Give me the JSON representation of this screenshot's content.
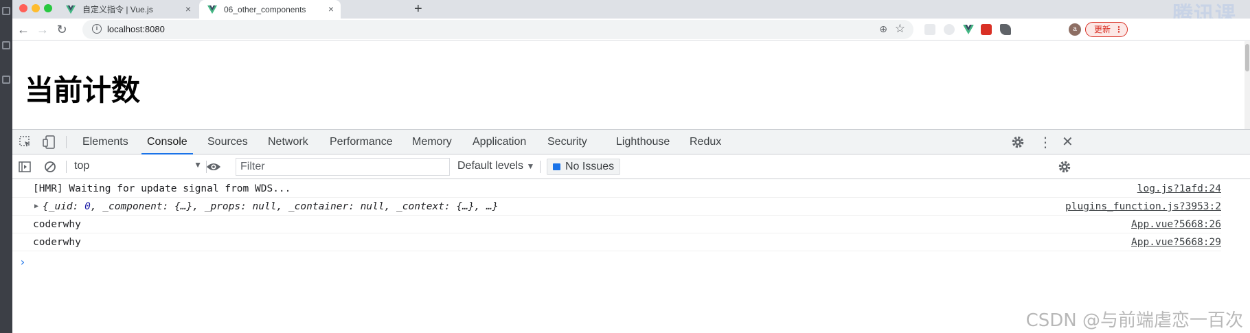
{
  "browser": {
    "tabs": [
      {
        "title": "自定义指令 | Vue.js",
        "active": false
      },
      {
        "title": "06_other_components",
        "active": true
      }
    ],
    "new_tab_symbol": "+",
    "close_symbol": "×",
    "address": "localhost:8080",
    "update_label": "更新",
    "avatar_initial": "a",
    "brand_watermark": "腾讯课"
  },
  "page": {
    "heading": "当前计数"
  },
  "devtools": {
    "tabs": [
      "Elements",
      "Console",
      "Sources",
      "Network",
      "Performance",
      "Memory",
      "Application",
      "Security",
      "Lighthouse",
      "Redux"
    ],
    "active_tab": "Console",
    "context": "top",
    "filter_placeholder": "Filter",
    "levels": "Default levels",
    "issues": "No Issues"
  },
  "console": {
    "rows": [
      {
        "message": "[HMR] Waiting for update signal from WDS...",
        "source": "log.js?1afd:24"
      },
      {
        "message_parts": [
          "{_uid: ",
          "0",
          ", _component: {…}, _props: null, _container: null, _context: {…}, …}"
        ],
        "source": "plugins_function.js?3953:2"
      },
      {
        "message": "coderwhy",
        "source": "App.vue?5668:26"
      },
      {
        "message": "coderwhy",
        "source": "App.vue?5668:29"
      }
    ],
    "prompt": "›"
  },
  "watermark": "CSDN @与前端虐恋一百次",
  "colors": {
    "accent": "#1a73e8",
    "update": "#d93025",
    "vue_green": "#41b883"
  }
}
